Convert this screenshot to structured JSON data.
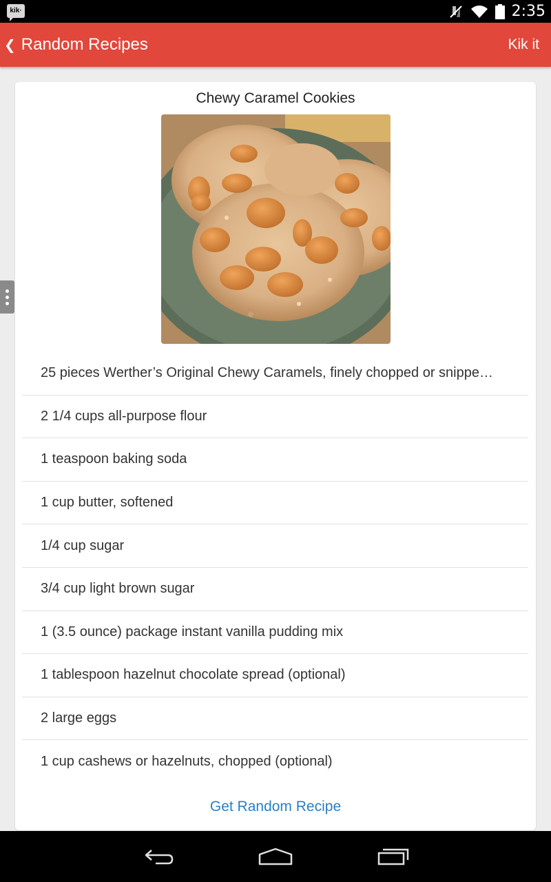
{
  "status_bar": {
    "notification_icon": "kik-icon",
    "notification_text": "kik·",
    "time": "2:35"
  },
  "action_bar": {
    "back_icon": "chevron-left-icon",
    "title": "Random Recipes",
    "action": "Kik it",
    "color": "#e2473b"
  },
  "recipe": {
    "title": "Chewy Caramel Cookies",
    "image": "chewy-caramel-cookies-photo",
    "ingredients": [
      "25 pieces Werther’s Original Chewy Caramels, finely chopped or snippe…",
      "2 1/4 cups all-purpose flour",
      "1 teaspoon baking soda",
      "1 cup butter, softened",
      "1/4 cup sugar",
      "3/4 cup light brown sugar",
      "1 (3.5 ounce) package instant vanilla pudding mix",
      "1 tablespoon hazelnut chocolate spread (optional)",
      "2 large eggs",
      "1 cup cashews or hazelnuts, chopped (optional)"
    ],
    "button_label": "Get Random Recipe",
    "button_color": "#2a7fc4"
  },
  "nav_bar": {
    "back_icon": "back-icon",
    "home_icon": "home-icon",
    "recents_icon": "recents-icon"
  }
}
